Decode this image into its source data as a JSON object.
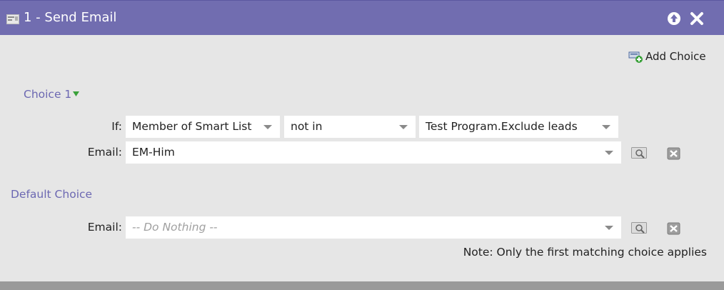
{
  "header": {
    "title": "1 - Send Email",
    "bg_color": "#716db0",
    "icons": [
      "flow-step-icon",
      "move-up-icon",
      "close-icon"
    ]
  },
  "toolbar": {
    "add_choice_label": "Add Choice"
  },
  "choice1": {
    "heading": "Choice 1",
    "if_label": "If:",
    "condition_field": "Member of Smart List",
    "operator": "not in",
    "value": "Test Program.Exclude leads",
    "email_label": "Email:",
    "email_value": "EM-Him"
  },
  "default_choice": {
    "heading": "Default Choice",
    "email_label": "Email:",
    "email_placeholder": "-- Do Nothing --"
  },
  "note": "Note: Only the first matching choice applies",
  "colors": {
    "accent": "#6c68b2",
    "background": "#e6e6e6"
  }
}
